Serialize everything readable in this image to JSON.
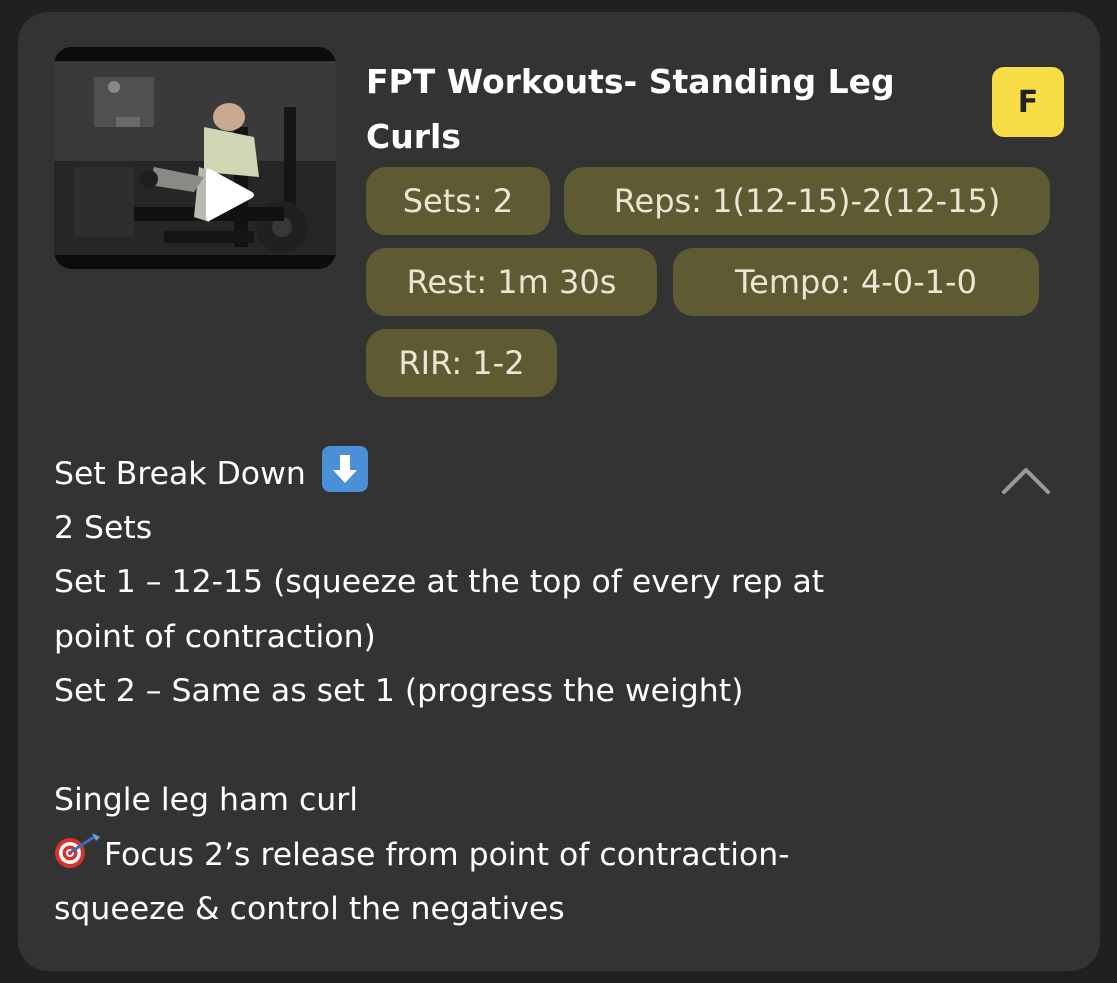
{
  "exercise": {
    "title": "FPT Workouts- Standing Leg Curls",
    "badge_letter": "F",
    "stats": {
      "sets": "Sets: 2",
      "reps": "Reps: 1(12-15)-2(12-15)",
      "rest": "Rest: 1m 30s",
      "tempo": "Tempo: 4-0-1-0",
      "rir": "RIR: 1-2"
    }
  },
  "description": {
    "line1": "Set Break Down",
    "line2": "2 Sets",
    "line3": "Set 1 – 12-15 (squeeze at the top of every rep at",
    "line4": "point of contraction)",
    "line5": "Set 2 – Same as set 1 (progress the weight)",
    "line6": "Single leg ham curl",
    "line7": "Focus 2’s release from point of contraction-",
    "line8": "squeeze & control the negatives"
  },
  "icons": {
    "down_arrow_emoji": "down-arrow-icon",
    "dart_emoji": "direct-hit-icon",
    "collapse": "chevron-up-icon",
    "play": "play-icon"
  },
  "colors": {
    "card_bg": "#333333",
    "pill_bg": "#5e5a31",
    "badge_bg": "#f8dd47",
    "chevron": "#9a9a9a"
  }
}
